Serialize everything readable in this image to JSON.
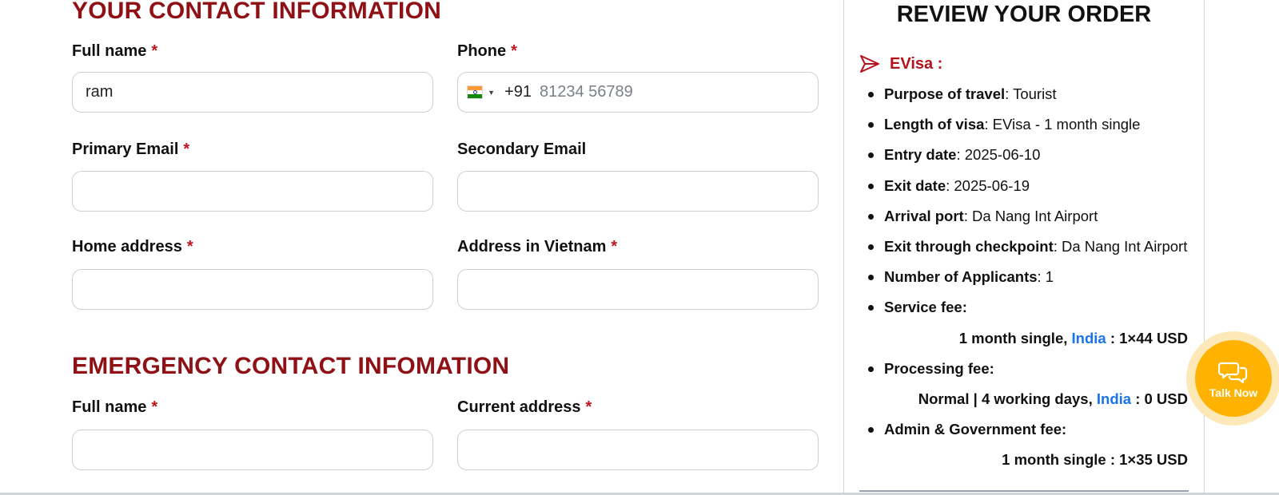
{
  "contact": {
    "title": "YOUR CONTACT INFORMATION",
    "required_mark": "*",
    "full_name_label": "Full name",
    "full_name_value": "ram",
    "phone_label": "Phone",
    "phone_dial_code": "+91",
    "phone_placeholder": "81234 56789",
    "phone_country_flag": "india-flag-icon",
    "primary_email_label": "Primary Email",
    "primary_email_value": "",
    "secondary_email_label": "Secondary Email",
    "secondary_email_value": "",
    "home_address_label": "Home address",
    "home_address_value": "",
    "address_vn_label": "Address in Vietnam",
    "address_vn_value": ""
  },
  "emergency": {
    "title": "EMERGENCY CONTACT INFOMATION",
    "full_name_label": "Full name",
    "full_name_value": "",
    "current_address_label": "Current address",
    "current_address_value": ""
  },
  "review": {
    "title": "REVIEW YOUR ORDER",
    "product": "EVisa :",
    "items": [
      {
        "label": "Purpose of travel",
        "value": ": Tourist"
      },
      {
        "label": "Length of visa",
        "value": ": EVisa - 1 month single"
      },
      {
        "label": "Entry date",
        "value": ": 2025-06-10"
      },
      {
        "label": "Exit date",
        "value": ": 2025-06-19"
      },
      {
        "label": "Arrival port",
        "value": ": Da Nang Int Airport"
      },
      {
        "label": "Exit through checkpoint",
        "value": ": Da Nang Int Airport"
      },
      {
        "label": "Number of Applicants",
        "value": ": 1"
      }
    ],
    "service_fee_label": "Service fee:",
    "service_fee_prefix": "1 month single, ",
    "service_fee_country": "India",
    "service_fee_amount": " : 1×44 USD",
    "processing_fee_label": "Processing fee:",
    "processing_fee_prefix": "Normal | 4 working days, ",
    "processing_fee_country": "India",
    "processing_fee_amount": " : 0 USD",
    "admin_fee_label": "Admin & Government fee:",
    "admin_fee_detail": "1 month single : 1×35 USD"
  },
  "chat": {
    "label": "Talk Now",
    "icon": "chat-bubbles-icon"
  },
  "colors": {
    "brand_red": "#8f1116",
    "required_red": "#c0151d",
    "link_blue": "#1a73e8",
    "chat_orange": "#ffb300"
  }
}
